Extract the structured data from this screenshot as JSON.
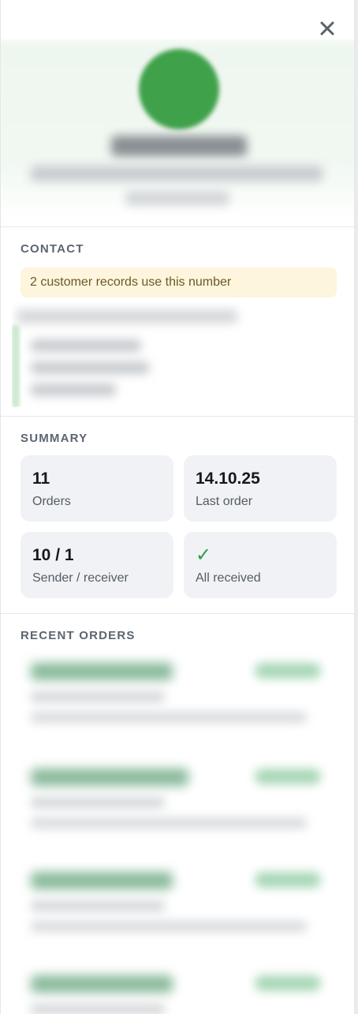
{
  "panel": {
    "close_label": "close"
  },
  "contact": {
    "title": "CONTACT",
    "warning": "2 customer records use this number"
  },
  "summary": {
    "title": "SUMMARY",
    "tiles": [
      {
        "value": "11",
        "label": "Orders"
      },
      {
        "value": "14.10.25",
        "label": "Last order"
      },
      {
        "value": "10 / 1",
        "label": "Sender / receiver"
      },
      {
        "value": "✓",
        "label": "All received"
      }
    ]
  },
  "recent_orders": {
    "title": "RECENT ORDERS"
  },
  "colors": {
    "avatar": "#3fa14a",
    "warning_bg": "#fdf5dd",
    "tile_bg": "#f0f2f5",
    "check": "#2e9c46"
  }
}
